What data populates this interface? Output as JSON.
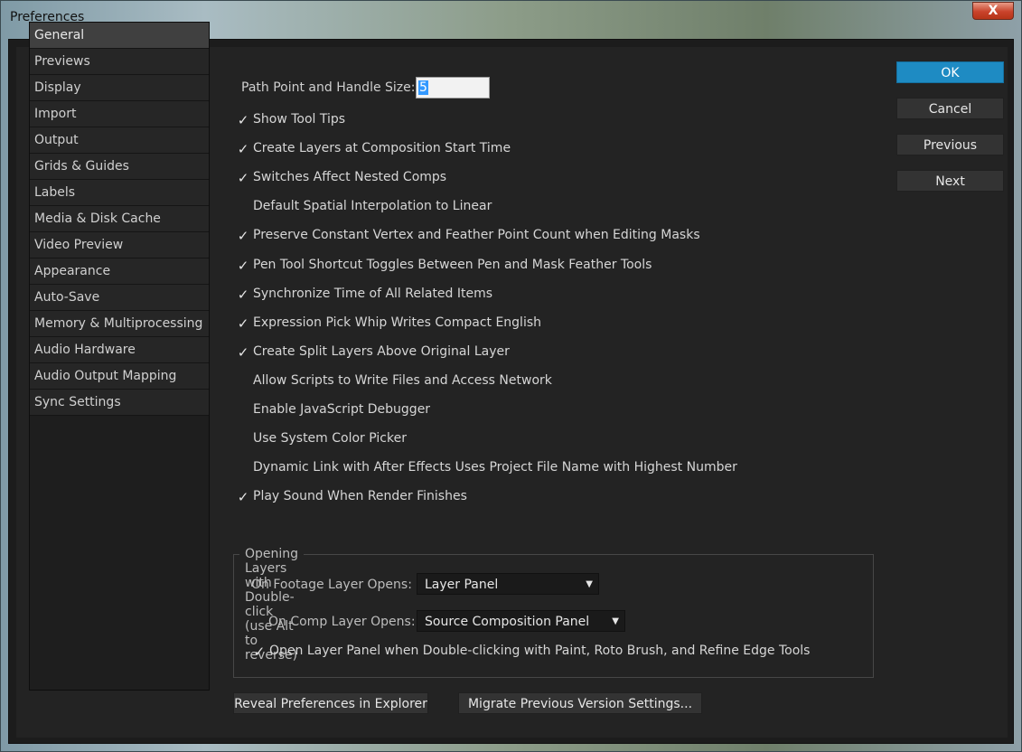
{
  "window": {
    "title": "Preferences",
    "close_label": "X"
  },
  "sidebar": {
    "items": [
      {
        "label": "General",
        "selected": true
      },
      {
        "label": "Previews"
      },
      {
        "label": "Display"
      },
      {
        "label": "Import"
      },
      {
        "label": "Output"
      },
      {
        "label": "Grids & Guides"
      },
      {
        "label": "Labels"
      },
      {
        "label": "Media & Disk Cache"
      },
      {
        "label": "Video Preview"
      },
      {
        "label": "Appearance"
      },
      {
        "label": "Auto-Save"
      },
      {
        "label": "Memory & Multiprocessing"
      },
      {
        "label": "Audio Hardware"
      },
      {
        "label": "Audio Output Mapping"
      },
      {
        "label": "Sync Settings"
      }
    ]
  },
  "general": {
    "path_point_label": "Path Point and Handle Size:",
    "path_point_value": "5",
    "checkboxes": [
      {
        "label": "Show Tool Tips",
        "checked": true
      },
      {
        "label": "Create Layers at Composition Start Time",
        "checked": true
      },
      {
        "label": "Switches Affect Nested Comps",
        "checked": true
      },
      {
        "label": "Default Spatial Interpolation to Linear",
        "checked": false
      },
      {
        "label": "Preserve Constant Vertex and Feather Point Count when Editing Masks",
        "checked": true
      },
      {
        "label": "Pen Tool Shortcut Toggles Between Pen and Mask Feather Tools",
        "checked": true
      },
      {
        "label": "Synchronize Time of All Related Items",
        "checked": true
      },
      {
        "label": "Expression Pick Whip Writes Compact English",
        "checked": true
      },
      {
        "label": "Create Split Layers Above Original Layer",
        "checked": true
      },
      {
        "label": "Allow Scripts to Write Files and Access Network",
        "checked": false
      },
      {
        "label": "Enable JavaScript Debugger",
        "checked": false
      },
      {
        "label": "Use System Color Picker",
        "checked": false
      },
      {
        "label": "Dynamic Link with After Effects Uses Project File Name with Highest Number",
        "checked": false
      },
      {
        "label": "Play Sound When Render Finishes",
        "checked": true
      }
    ]
  },
  "double_click_group": {
    "title": "Opening Layers with Double-click (use Alt to reverse)",
    "footage_label": "On Footage Layer Opens:",
    "footage_value": "Layer Panel",
    "comp_label": "On Comp Layer Opens:",
    "comp_value": "Source Composition Panel",
    "open_panel_label": "Open Layer Panel when Double-clicking with Paint, Roto Brush, and Refine Edge Tools",
    "open_panel_checked": true
  },
  "bottom_buttons": {
    "reveal": "Reveal Preferences in Explorer",
    "migrate": "Migrate Previous Version Settings..."
  },
  "dialog_buttons": {
    "ok": "OK",
    "cancel": "Cancel",
    "previous": "Previous",
    "next": "Next"
  },
  "check_glyph": "✓",
  "dropdown_arrow_glyph": "▼"
}
